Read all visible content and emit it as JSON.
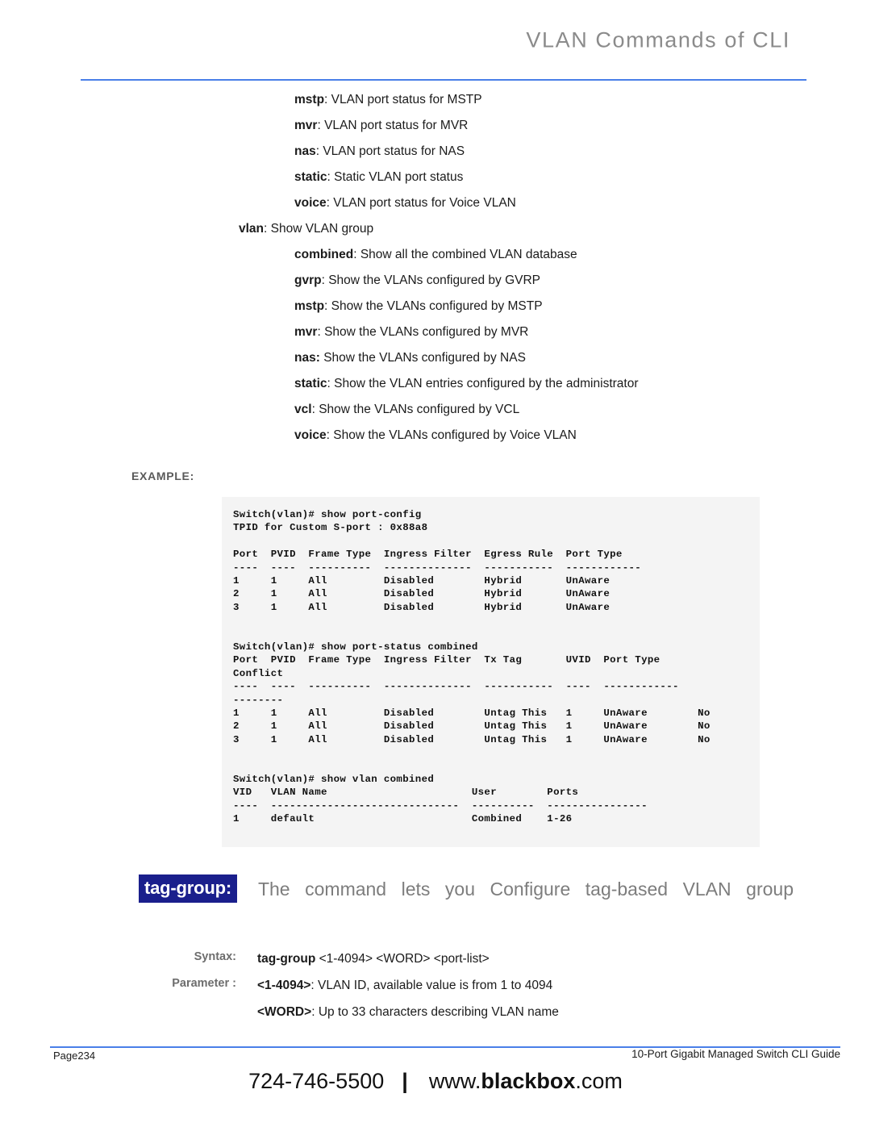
{
  "header": {
    "title": "VLAN Commands of CLI"
  },
  "descriptions": [
    {
      "term": "mstp",
      "sep": ": ",
      "text": "VLAN port status for MSTP",
      "level": "lvl-a"
    },
    {
      "term": "mvr",
      "sep": ": ",
      "text": "VLAN port status for MVR",
      "level": "lvl-a"
    },
    {
      "term": "nas",
      "sep": ":   ",
      "text": "VLAN port status for NAS",
      "level": "lvl-a"
    },
    {
      "term": "static",
      "sep": ": ",
      "text": "Static VLAN port status",
      "level": "lvl-a"
    },
    {
      "term": "voice",
      "sep": ": ",
      "text": "VLAN port status for Voice VLAN",
      "level": "lvl-a"
    },
    {
      "term": "vlan",
      "sep": ": ",
      "text": "Show VLAN group",
      "level": "indent-0"
    },
    {
      "term": "combined",
      "sep": ":   ",
      "text": "Show all the combined VLAN database",
      "level": "lvl-b"
    },
    {
      "term": "gvrp",
      "sep": ": ",
      "text": "Show the VLANs configured by GVRP",
      "level": "lvl-b"
    },
    {
      "term": "mstp",
      "sep": ": ",
      "text": "Show the VLANs configured by MSTP",
      "level": "lvl-b"
    },
    {
      "term": "mvr",
      "sep": ": ",
      "text": "Show the VLANs configured by MVR",
      "level": "lvl-b"
    },
    {
      "term": "nas:",
      "sep": " ",
      "text": "Show the VLANs configured by NAS",
      "level": "lvl-b"
    },
    {
      "term": "static",
      "sep": ": ",
      "text": "Show the VLAN entries configured by the administrator",
      "level": "lvl-b"
    },
    {
      "term": "vcl",
      "sep": ": ",
      "text": "Show the VLANs configured by VCL",
      "level": "lvl-b"
    },
    {
      "term": "voice",
      "sep": ": ",
      "text": "Show the VLANs configured by Voice VLAN",
      "level": "lvl-b"
    }
  ],
  "example": {
    "label": "EXAMPLE:",
    "terminal_lines": [
      "Switch(vlan)# show port-config",
      "TPID for Custom S-port : 0x88a8",
      "",
      "Port  PVID  Frame Type  Ingress Filter  Egress Rule  Port Type",
      "----  ----  ----------  --------------  -----------  ------------",
      "1     1     All         Disabled        Hybrid       UnAware",
      "2     1     All         Disabled        Hybrid       UnAware",
      "3     1     All         Disabled        Hybrid       UnAware",
      "",
      "",
      "Switch(vlan)# show port-status combined",
      "Port  PVID  Frame Type  Ingress Filter  Tx Tag       UVID  Port Type",
      "Conflict",
      "----  ----  ----------  --------------  -----------  ----  ------------",
      "--------",
      "1     1     All         Disabled        Untag This   1     UnAware        No",
      "2     1     All         Disabled        Untag This   1     UnAware        No",
      "3     1     All         Disabled        Untag This   1     UnAware        No",
      "",
      "",
      "Switch(vlan)# show vlan combined",
      "VID   VLAN Name                       User        Ports",
      "----  ------------------------------  ----------  ----------------",
      "1     default                         Combined    1-26"
    ]
  },
  "tag_group": {
    "chip_label": "tag-group:",
    "description": "The command lets you Configure tag-based VLAN group"
  },
  "syntax_section": {
    "syntax_label": "Syntax:",
    "syntax_cmd": "tag-group",
    "syntax_args": " <1-4094> <WORD> <port-list>",
    "parameter_label": "Parameter :",
    "parameters": [
      {
        "name": "<1-4094>",
        "sep": ": ",
        "text": "VLAN ID, available value is from 1 to 4094"
      },
      {
        "name": "<WORD>",
        "sep": ": ",
        "text": "Up to 33 characters describing VLAN name"
      }
    ]
  },
  "footer": {
    "page": "Page234",
    "guide": "10-Port Gigabit Managed Switch CLI Guide",
    "phone": "724-746-5500",
    "separator": "|",
    "site_prefix": "www.",
    "site_bold": "blackbox",
    "site_suffix": ".com"
  },
  "colors": {
    "rule_blue": "#4a7fe8",
    "chip_navy": "#1a1f8c",
    "header_gray": "#8b8b8b",
    "terminal_bg": "#f4f4f4"
  }
}
